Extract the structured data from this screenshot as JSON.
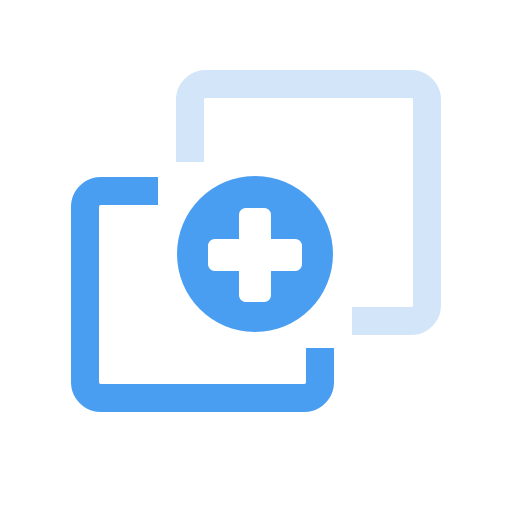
{
  "icon": {
    "name": "duplicate-add-icon",
    "colors": {
      "primary": "#4A9EF2",
      "secondary": "#D3E5F8",
      "background": "#FFFFFF",
      "glyph": "#FFFFFF"
    }
  }
}
